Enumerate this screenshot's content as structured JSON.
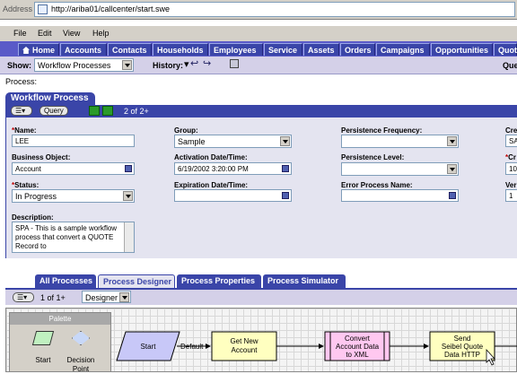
{
  "address": {
    "label": "Address",
    "url": "http://ariba01/callcenter/start.swe"
  },
  "menu": [
    "File",
    "Edit",
    "View",
    "Help"
  ],
  "tabs": [
    "Home",
    "Accounts",
    "Contacts",
    "Households",
    "Employees",
    "Service",
    "Assets",
    "Orders",
    "Campaigns",
    "Opportunities",
    "Quot"
  ],
  "showbar": {
    "show_label": "Show:",
    "show_value": "Workflow Processes",
    "history_label": "History:",
    "right_text": "Que"
  },
  "process_label": "Process:",
  "form": {
    "title": "Workflow Process",
    "menu_button": "☰▾",
    "query_button": "Query",
    "record_count": "2 of 2+",
    "fields": {
      "name_label": "Name:",
      "name_value": "LEE",
      "business_object_label": "Business Object:",
      "business_object_value": "Account",
      "status_label": "Status:",
      "status_value": "In Progress",
      "description_label": "Description:",
      "description_value": "SPA - This is a sample workflow process that convert a QUOTE  Record to",
      "group_label": "Group:",
      "group_value": "Sample",
      "activation_label": "Activation Date/Time:",
      "activation_value": "6/19/2002 3:20:00 PM",
      "expiration_label": "Expiration Date/Time:",
      "expiration_value": "",
      "persistence_freq_label": "Persistence Frequency:",
      "persistence_freq_value": "",
      "persistence_level_label": "Persistence Level:",
      "persistence_level_value": "",
      "error_process_label": "Error Process Name:",
      "error_process_value": "",
      "col4_label1": "Cre",
      "col4_value1": "SA",
      "col4_label2": "Cr",
      "col4_value2": "10/",
      "col4_label3": "Ver",
      "col4_value3": "1"
    }
  },
  "bottom_tabs": [
    "All Processes",
    "Process Designer",
    "Process Properties",
    "Process Simulator"
  ],
  "bottom_toolbar": {
    "record_count": "1 of 1+",
    "view_value": "Designer"
  },
  "palette": {
    "title": "Palette",
    "items": [
      "Start",
      "Decision Point"
    ]
  },
  "diagram": {
    "nodes": [
      "Start",
      "Get New Account",
      "Convert Account Data to XML",
      "Send Seibel Quote Data HTTP"
    ],
    "edge_label": "Default"
  },
  "colors": {
    "tab_blue": "#3a45a8",
    "tab_bar": "#5a5ac8",
    "panel_bg": "#e4e4f0",
    "task_yellow": "#ffffc0",
    "subproc_pink": "#ffc8f0",
    "start_lilac": "#c8c8f8"
  }
}
